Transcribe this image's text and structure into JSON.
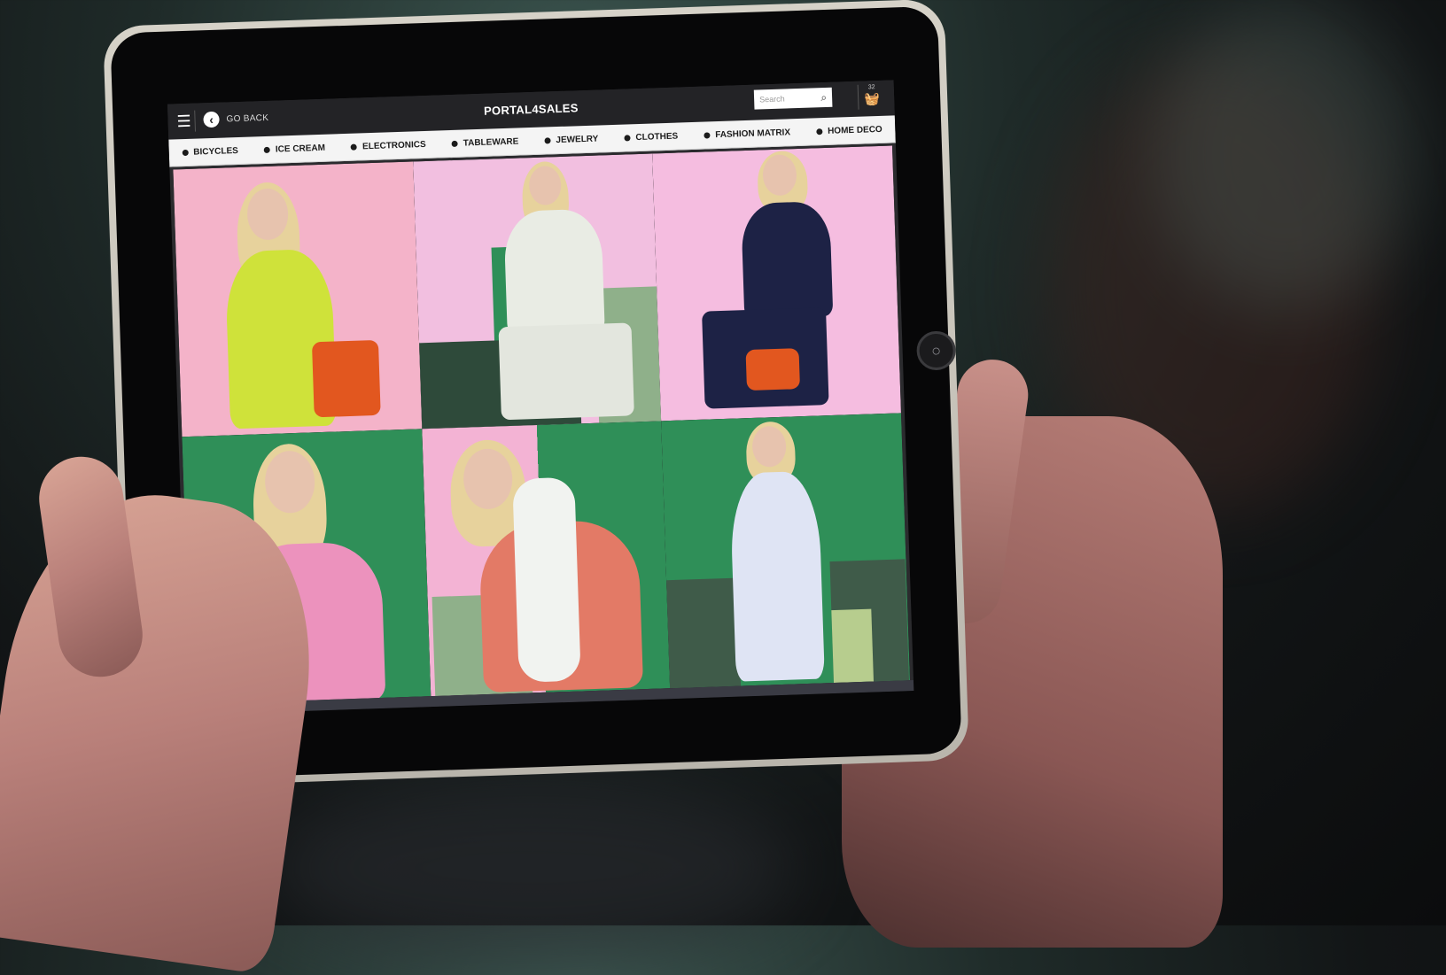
{
  "app": {
    "brand": "PORTAL4SALES",
    "back_label": "GO BACK",
    "search_placeholder": "Search",
    "cart_count": "32"
  },
  "categories": [
    {
      "label": "BICYCLES"
    },
    {
      "label": "ICE CREAM"
    },
    {
      "label": "ELECTRONICS"
    },
    {
      "label": "TABLEWARE"
    },
    {
      "label": "JEWELRY"
    },
    {
      "label": "CLOTHES"
    },
    {
      "label": "FASHION MATRIX"
    },
    {
      "label": "HOME DECO"
    }
  ],
  "colors": {
    "pink": "#f4b3c9",
    "light_pink": "#f2bfe0",
    "green": "#2f8f58",
    "dark_green": "#2e4a3a",
    "sage": "#8fb08a",
    "navy": "#1d2245",
    "orange": "#e2571f"
  },
  "icons": {
    "menu": "menu-icon",
    "back": "chevron-left-icon",
    "search": "search-icon",
    "cart": "basket-icon",
    "home": "home-button-icon"
  }
}
